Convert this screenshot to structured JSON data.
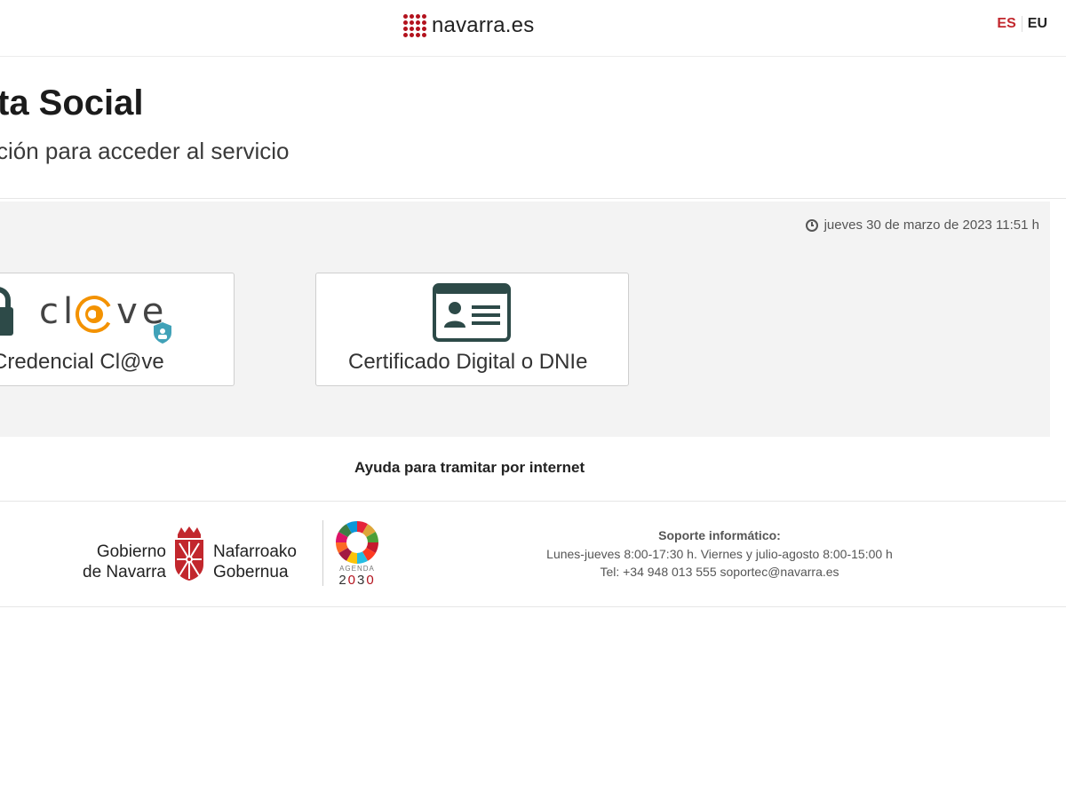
{
  "header": {
    "brand": "navarra.es",
    "languages": {
      "es": "ES",
      "eu": "EU"
    }
  },
  "page": {
    "title": "ta Social",
    "subtitle": "ción para acceder al servicio"
  },
  "panel": {
    "datetime": "jueves 30 de marzo de 2023 11:51 h",
    "options": {
      "clave_logo_text": "cl",
      "clave_logo_end": "ve",
      "clave_label": "Credencial Cl@ve",
      "certificate_label": "Certificado Digital o DNIe"
    }
  },
  "help": {
    "label": "Ayuda para tramitar por internet"
  },
  "footer": {
    "government": {
      "line1_es": "Gobierno",
      "line2_es": "de Navarra",
      "line1_eu": "Nafarroako",
      "line2_eu": "Gobernua"
    },
    "agenda": {
      "label": "AGENDA",
      "year_start": "2",
      "year_zero_1": "0",
      "year_three": "3",
      "year_zero_2": "0"
    },
    "support": {
      "title": "Soporte informático:",
      "hours": "Lunes-jueves 8:00-17:30 h. Viernes y julio-agosto 8:00-15:00 h",
      "contact": "Tel: +34 948 013 555 soportec@navarra.es"
    }
  },
  "colors": {
    "brand_red": "#b3121d",
    "lang_active": "#c2272d",
    "clave_orange": "#f39200",
    "clave_teal": "#41a2b8",
    "card_icon": "#2d4a48"
  },
  "icons": {
    "brand": "navarra-dots-logo",
    "clock": "clock-icon",
    "lock": "padlock-icon",
    "badge": "user-shield-icon",
    "certificate": "id-card-icon",
    "shield": "navarra-coat-of-arms",
    "agenda": "sdg-wheel-icon"
  }
}
